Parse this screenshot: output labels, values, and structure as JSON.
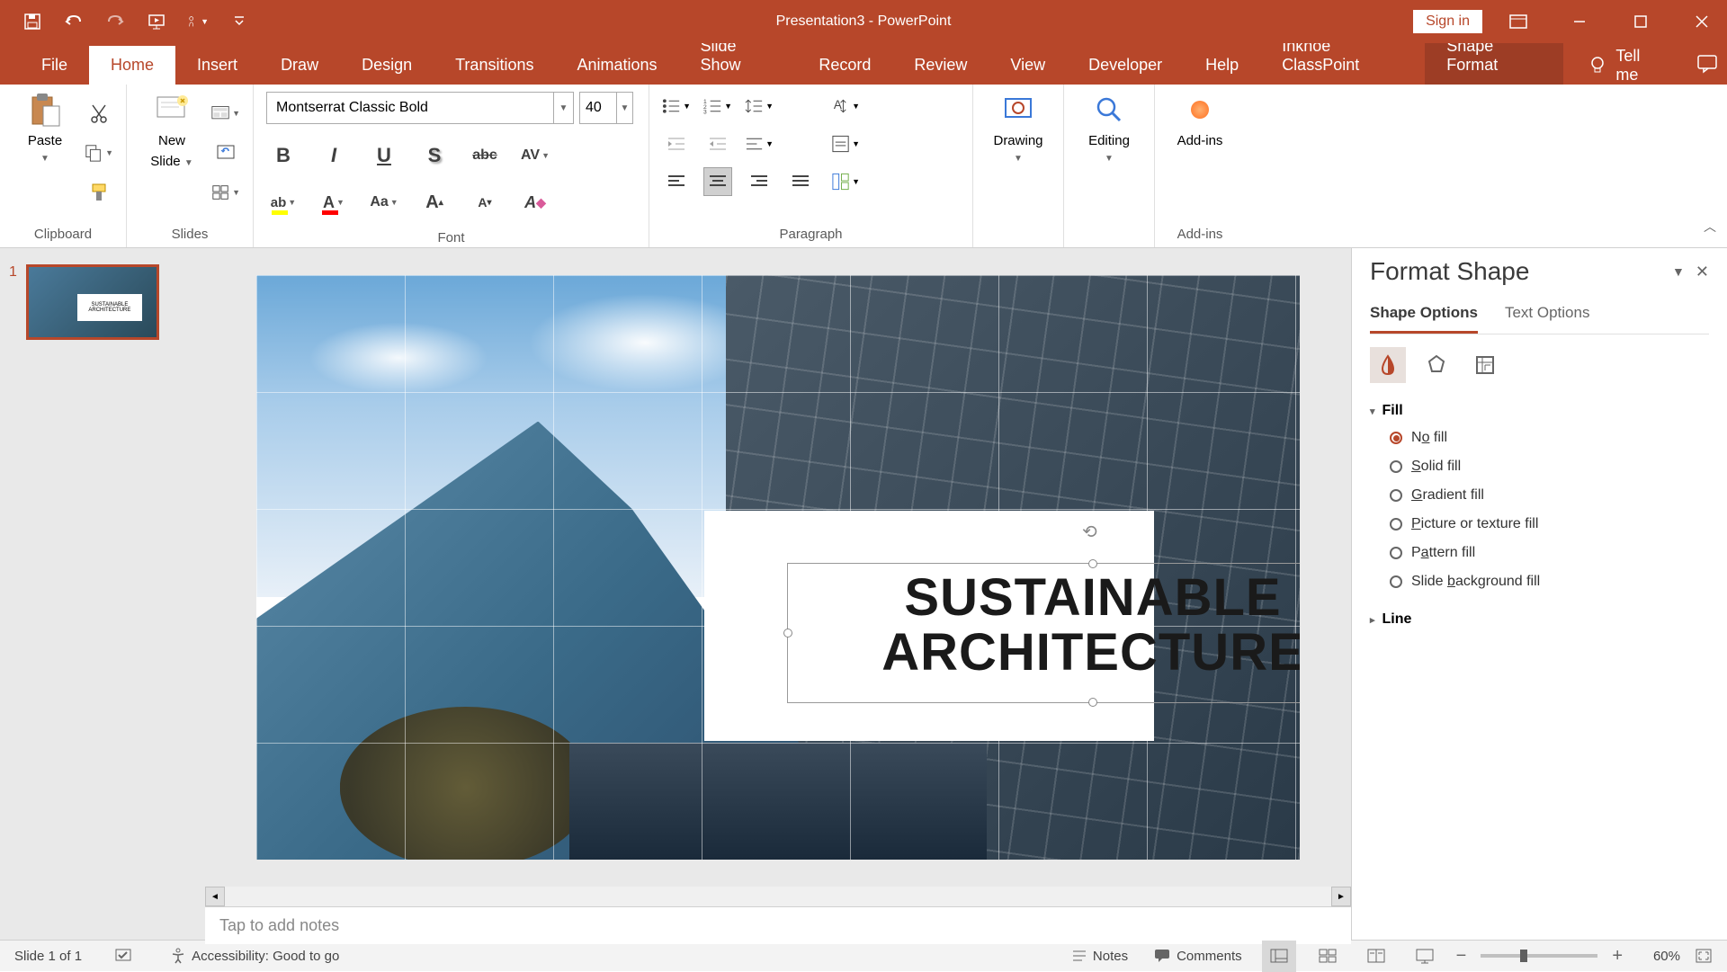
{
  "title": "Presentation3  -  PowerPoint",
  "signin": "Sign in",
  "tellme": "Tell me",
  "tabs": {
    "file": "File",
    "home": "Home",
    "insert": "Insert",
    "draw": "Draw",
    "design": "Design",
    "transitions": "Transitions",
    "animations": "Animations",
    "slideshow": "Slide Show",
    "record": "Record",
    "review": "Review",
    "view": "View",
    "developer": "Developer",
    "help": "Help",
    "inknoe": "Inknoe ClassPoint",
    "shapeformat": "Shape Format"
  },
  "groups": {
    "clipboard": "Clipboard",
    "slides": "Slides",
    "font": "Font",
    "paragraph": "Paragraph",
    "addins": "Add-ins"
  },
  "buttons": {
    "paste": "Paste",
    "newslide1": "New",
    "newslide2": "Slide",
    "drawing": "Drawing",
    "editing": "Editing",
    "addins": "Add-ins"
  },
  "font": {
    "name": "Montserrat Classic Bold",
    "size": "40"
  },
  "slide": {
    "text1": "SUSTAINABLE",
    "text2": "ARCHITECTURE",
    "thumb_text": "SUSTAINABLE ARCHITECTURE",
    "number": "1"
  },
  "notes_placeholder": "Tap to add notes",
  "pane": {
    "title": "Format Shape",
    "tab_shape": "Shape Options",
    "tab_text": "Text Options",
    "fill": "Fill",
    "line": "Line",
    "nofill_pre": "N",
    "nofill_u": "o",
    "nofill_post": " fill",
    "solid_pre": "",
    "solid_u": "S",
    "solid_post": "olid fill",
    "grad_pre": "",
    "grad_u": "G",
    "grad_post": "radient fill",
    "pic_pre": "",
    "pic_u": "P",
    "pic_post": "icture or texture fill",
    "pat_pre": "P",
    "pat_u": "a",
    "pat_post": "ttern fill",
    "bg_pre": "Slide ",
    "bg_u": "b",
    "bg_post": "ackground fill"
  },
  "status": {
    "slide_of": "Slide 1 of 1",
    "accessibility": "Accessibility: Good to go",
    "notes": "Notes",
    "comments": "Comments",
    "zoom": "60%"
  }
}
